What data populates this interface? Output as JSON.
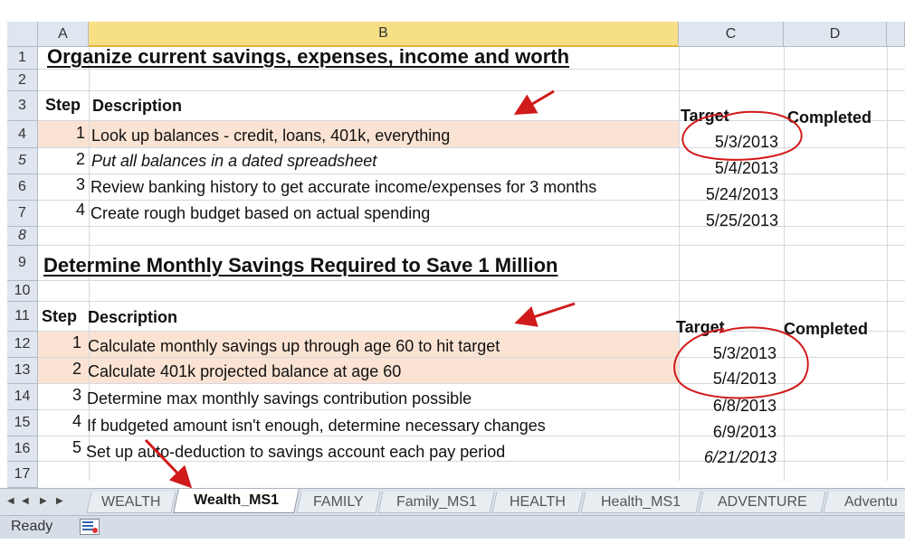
{
  "columns": [
    "A",
    "B",
    "C",
    "D"
  ],
  "rows": [
    "1",
    "2",
    "3",
    "4",
    "5",
    "6",
    "7",
    "8",
    "9",
    "10",
    "11",
    "12",
    "13",
    "14",
    "15",
    "16",
    "17"
  ],
  "section1": {
    "title": "Organize current savings, expenses, income and worth",
    "step_header": "Step",
    "description_header": "Description",
    "target_header": "Target",
    "completed_header": "Completed",
    "items": [
      {
        "step": "1",
        "description": "Look up balances - credit, loans, 401k, everything",
        "target": "5/3/2013"
      },
      {
        "step": "2",
        "description": "Put all balances in a dated spreadsheet",
        "target": "5/4/2013"
      },
      {
        "step": "3",
        "description": "Review banking history to get accurate income/expenses for 3 months",
        "target": "5/24/2013"
      },
      {
        "step": "4",
        "description": "Create rough budget based on actual spending",
        "target": "5/25/2013"
      }
    ]
  },
  "section2": {
    "title": "Determine Monthly Savings Required to Save 1 Million",
    "step_header": "Step",
    "description_header": "Description",
    "target_header": "Target",
    "completed_header": "Completed",
    "items": [
      {
        "step": "1",
        "description": "Calculate monthly savings up through age 60 to hit target",
        "target": "5/3/2013"
      },
      {
        "step": "2",
        "description": "Calculate 401k projected balance at age 60",
        "target": "5/4/2013"
      },
      {
        "step": "3",
        "description": "Determine max monthly savings contribution possible",
        "target": "6/8/2013"
      },
      {
        "step": "4",
        "description": "If budgeted amount isn't enough, determine necessary changes",
        "target": "6/9/2013"
      },
      {
        "step": "5",
        "description": "Set up auto-deduction to savings account each pay period",
        "target": "6/21/2013"
      }
    ]
  },
  "sheet_tabs": [
    "WEALTH",
    "Wealth_MS1",
    "FAMILY",
    "Family_MS1",
    "HEALTH",
    "Health_MS1",
    "ADVENTURE",
    "Adventu"
  ],
  "active_tab": "Wealth_MS1",
  "status": {
    "ready": "Ready"
  },
  "nav": [
    "◀",
    "◀",
    "▶",
    "▶"
  ],
  "colors": {
    "annotation": "#d11a1a",
    "highlight": "#fbe3d3",
    "header_bg": "#dfe6ef",
    "selected_header": "#f7df86"
  },
  "icons": {
    "macro": "macro-record-icon",
    "arrow": "annotation-arrow-icon",
    "circle": "annotation-circle-icon"
  }
}
